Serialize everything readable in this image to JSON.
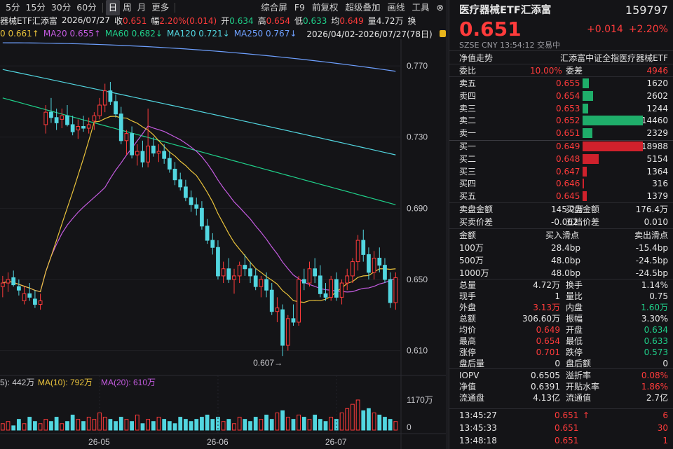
{
  "toolbar": {
    "periods": [
      "5分",
      "15分",
      "30分",
      "60分",
      "日",
      "周",
      "月",
      "更多"
    ],
    "active": "日",
    "right_items": [
      "综合屏",
      "F9",
      "前复权",
      "超级叠加",
      "画线",
      "工具"
    ]
  },
  "info_line": {
    "name": "器械ETF汇添富",
    "date": "2026/07/27",
    "close_label": "收",
    "close": "0.651",
    "change_label": "幅",
    "change": "2.20%(0.014)",
    "open_label": "开",
    "open": "0.634",
    "high_label": "高",
    "high": "0.654",
    "low_label": "低",
    "low": "0.633",
    "avg_label": "均",
    "avg": "0.649",
    "vol_label": "量",
    "vol": "4.72万",
    "exchange_label": "换"
  },
  "ma_line": {
    "ma10": "0  0.661↑",
    "ma20": "MA20  0.655↑",
    "ma60": "MA60  0.682↓",
    "ma120": "MA120  0.721↓",
    "ma250": "MA250  0.767↓",
    "range": "2026/04/02-2026/07/27(78日)"
  },
  "vol_legend": {
    "v5": "5): 442万",
    "v10": "MA(10): 792万",
    "v20": "MA(20): 610万"
  },
  "chart_data": {
    "type": "candlestick",
    "y_ticks": [
      "0.770",
      "0.730",
      "0.690",
      "0.650",
      "0.610"
    ],
    "y_tick_values": [
      0.77,
      0.73,
      0.69,
      0.65,
      0.61
    ],
    "x_ticks": [
      "26-05",
      "26-06",
      "26-07"
    ],
    "min_label": "0.607→",
    "min_value": 0.607,
    "vol_ticks": [
      "1170万",
      "0"
    ],
    "candles": [
      [
        0.646,
        0.652,
        0.64,
        0.648
      ],
      [
        0.648,
        0.654,
        0.643,
        0.65
      ],
      [
        0.651,
        0.655,
        0.646,
        0.647
      ],
      [
        0.646,
        0.65,
        0.641,
        0.644
      ],
      [
        0.638,
        0.646,
        0.636,
        0.642
      ],
      [
        0.642,
        0.648,
        0.638,
        0.64
      ],
      [
        0.639,
        0.644,
        0.634,
        0.636
      ],
      [
        0.636,
        0.642,
        0.633,
        0.638
      ],
      [
        0.737,
        0.748,
        0.732,
        0.744
      ],
      [
        0.744,
        0.752,
        0.738,
        0.741
      ],
      [
        0.741,
        0.746,
        0.734,
        0.738
      ],
      [
        0.74,
        0.746,
        0.735,
        0.742
      ],
      [
        0.742,
        0.748,
        0.736,
        0.737
      ],
      [
        0.737,
        0.742,
        0.731,
        0.733
      ],
      [
        0.734,
        0.74,
        0.729,
        0.736
      ],
      [
        0.736,
        0.742,
        0.733,
        0.735
      ],
      [
        0.735,
        0.741,
        0.732,
        0.737
      ],
      [
        0.739,
        0.744,
        0.734,
        0.742
      ],
      [
        0.742,
        0.752,
        0.74,
        0.748
      ],
      [
        0.748,
        0.76,
        0.744,
        0.756
      ],
      [
        0.756,
        0.761,
        0.748,
        0.75
      ],
      [
        0.75,
        0.754,
        0.741,
        0.743
      ],
      [
        0.743,
        0.747,
        0.726,
        0.728
      ],
      [
        0.728,
        0.734,
        0.72,
        0.732
      ],
      [
        0.732,
        0.736,
        0.718,
        0.72
      ],
      [
        0.72,
        0.726,
        0.714,
        0.722
      ],
      [
        0.722,
        0.728,
        0.713,
        0.716
      ],
      [
        0.716,
        0.746,
        0.713,
        0.725
      ],
      [
        0.725,
        0.73,
        0.719,
        0.721
      ],
      [
        0.721,
        0.726,
        0.716,
        0.722
      ],
      [
        0.722,
        0.726,
        0.715,
        0.718
      ],
      [
        0.718,
        0.722,
        0.71,
        0.712
      ],
      [
        0.712,
        0.716,
        0.703,
        0.706
      ],
      [
        0.706,
        0.71,
        0.7,
        0.702
      ],
      [
        0.702,
        0.706,
        0.694,
        0.696
      ],
      [
        0.696,
        0.7,
        0.688,
        0.692
      ],
      [
        0.692,
        0.696,
        0.686,
        0.69
      ],
      [
        0.69,
        0.694,
        0.678,
        0.68
      ],
      [
        0.68,
        0.684,
        0.67,
        0.672
      ],
      [
        0.672,
        0.676,
        0.664,
        0.668
      ],
      [
        0.668,
        0.672,
        0.65,
        0.652
      ],
      [
        0.652,
        0.66,
        0.648,
        0.656
      ],
      [
        0.656,
        0.662,
        0.648,
        0.65
      ],
      [
        0.65,
        0.656,
        0.642,
        0.652
      ],
      [
        0.652,
        0.66,
        0.648,
        0.658
      ],
      [
        0.658,
        0.664,
        0.652,
        0.656
      ],
      [
        0.656,
        0.66,
        0.648,
        0.652
      ],
      [
        0.652,
        0.656,
        0.644,
        0.646
      ],
      [
        0.646,
        0.652,
        0.64,
        0.65
      ],
      [
        0.65,
        0.654,
        0.64,
        0.644
      ],
      [
        0.644,
        0.648,
        0.63,
        0.632
      ],
      [
        0.632,
        0.64,
        0.626,
        0.634
      ],
      [
        0.633,
        0.636,
        0.607,
        0.613
      ],
      [
        0.613,
        0.63,
        0.61,
        0.628
      ],
      [
        0.628,
        0.636,
        0.624,
        0.626
      ],
      [
        0.626,
        0.652,
        0.624,
        0.65
      ],
      [
        0.65,
        0.656,
        0.644,
        0.648
      ],
      [
        0.648,
        0.66,
        0.646,
        0.656
      ],
      [
        0.656,
        0.662,
        0.648,
        0.652
      ],
      [
        0.652,
        0.658,
        0.64,
        0.642
      ],
      [
        0.642,
        0.648,
        0.638,
        0.64
      ],
      [
        0.64,
        0.652,
        0.638,
        0.65
      ],
      [
        0.65,
        0.654,
        0.638,
        0.64
      ],
      [
        0.64,
        0.65,
        0.636,
        0.648
      ],
      [
        0.648,
        0.656,
        0.644,
        0.652
      ],
      [
        0.652,
        0.662,
        0.648,
        0.66
      ],
      [
        0.66,
        0.675,
        0.655,
        0.672
      ],
      [
        0.672,
        0.678,
        0.66,
        0.664
      ],
      [
        0.664,
        0.668,
        0.65,
        0.654
      ],
      [
        0.654,
        0.666,
        0.65,
        0.662
      ],
      [
        0.662,
        0.668,
        0.654,
        0.658
      ],
      [
        0.658,
        0.662,
        0.648,
        0.65
      ],
      [
        0.65,
        0.654,
        0.634,
        0.637
      ],
      [
        0.637,
        0.654,
        0.633,
        0.651
      ]
    ],
    "volumes": [
      3,
      4,
      2,
      5,
      3,
      6,
      4,
      3,
      5,
      4,
      6,
      3,
      4,
      7,
      5,
      4,
      6,
      5,
      8,
      6,
      5,
      4,
      6,
      5,
      4,
      7,
      3,
      5,
      4,
      6,
      5,
      4,
      3,
      6,
      5,
      4,
      5,
      6,
      7,
      5,
      6,
      4,
      5,
      3,
      6,
      5,
      4,
      6,
      5,
      7,
      5,
      8,
      9,
      6,
      5,
      7,
      6,
      5,
      7,
      5,
      4,
      6,
      5,
      8,
      10,
      12,
      14,
      9,
      10,
      8,
      7,
      6,
      5,
      4
    ],
    "vol_max": 14
  },
  "panel": {
    "title": "医疗器械ETF汇添富",
    "code": "159797",
    "price": "0.651",
    "change": "+0.014",
    "change_pct": "+2.20%",
    "sub": "SZSE  CNY  13:54:12  交易中",
    "nav_label": "净值走势",
    "fund_name": "汇添富中证全指医疗器械ETF",
    "weibi_label": "委比",
    "weibi": "10.00%",
    "weicha_label": "委差",
    "weicha": "4946",
    "sells": [
      {
        "label": "卖五",
        "price": "0.655",
        "vol": "1620",
        "bar": 11
      },
      {
        "label": "卖四",
        "price": "0.654",
        "vol": "2602",
        "bar": 18
      },
      {
        "label": "卖三",
        "price": "0.653",
        "vol": "1244",
        "bar": 9
      },
      {
        "label": "卖二",
        "price": "0.652",
        "vol": "14460",
        "bar": 100
      },
      {
        "label": "卖一",
        "price": "0.651",
        "vol": "2329",
        "bar": 16
      }
    ],
    "buys": [
      {
        "label": "买一",
        "price": "0.649",
        "vol": "18988",
        "bar": 100
      },
      {
        "label": "买二",
        "price": "0.648",
        "vol": "5154",
        "bar": 27
      },
      {
        "label": "买三",
        "price": "0.647",
        "vol": "1364",
        "bar": 7
      },
      {
        "label": "买四",
        "price": "0.646",
        "vol": "316",
        "bar": 2
      },
      {
        "label": "买五",
        "price": "0.645",
        "vol": "1379",
        "bar": 7
      }
    ],
    "sell_amount_label": "卖盘金额",
    "sell_amount": "145.2万",
    "buy_amount_label": "买盘金额",
    "buy_amount": "176.4万",
    "spread_label": "买卖价差",
    "spread": "-0.002",
    "fivegap_label": "五档价差",
    "fivegap": "0.010",
    "slip_header": [
      "金额",
      "买入滑点",
      "卖出滑点"
    ],
    "slips": [
      {
        "amt": "100万",
        "buy": "28.4bp",
        "sell": "-15.4bp"
      },
      {
        "amt": "500万",
        "buy": "48.0bp",
        "sell": "-24.5bp"
      },
      {
        "amt": "1000万",
        "buy": "48.0bp",
        "sell": "-24.5bp"
      }
    ],
    "stats": [
      {
        "l1": "总量",
        "v1": "4.72万",
        "c1": "white",
        "l2": "换手",
        "v2": "1.14%",
        "c2": "white"
      },
      {
        "l1": "现手",
        "v1": "1",
        "c1": "white",
        "l2": "量比",
        "v2": "0.75",
        "c2": "white"
      },
      {
        "l1": "外盘",
        "v1": "3.13万",
        "c1": "red",
        "l2": "内盘",
        "v2": "1.60万",
        "c2": "green"
      },
      {
        "l1": "总额",
        "v1": "306.60万",
        "c1": "white",
        "l2": "振幅",
        "v2": "3.30%",
        "c2": "white"
      },
      {
        "l1": "均价",
        "v1": "0.649",
        "c1": "red",
        "l2": "开盘",
        "v2": "0.634",
        "c2": "green"
      },
      {
        "l1": "最高",
        "v1": "0.654",
        "c1": "red",
        "l2": "最低",
        "v2": "0.633",
        "c2": "green"
      },
      {
        "l1": "涨停",
        "v1": "0.701",
        "c1": "red",
        "l2": "跌停",
        "v2": "0.573",
        "c2": "green"
      },
      {
        "l1": "盘后量",
        "v1": "0",
        "c1": "white",
        "l2": "盘后额",
        "v2": "0",
        "c2": "white"
      }
    ],
    "stats2": [
      {
        "l1": "IOPV",
        "v1": "0.6505",
        "c1": "white",
        "l2": "溢折率",
        "v2": "0.08%",
        "c2": "red"
      },
      {
        "l1": "净值",
        "v1": "0.6391",
        "c1": "white",
        "l2": "开贴水率",
        "v2": "1.86%",
        "c2": "red"
      },
      {
        "l1": "流通盘",
        "v1": "4.13亿",
        "c1": "white",
        "l2": "流通值",
        "v2": "2.7亿",
        "c2": "white"
      }
    ],
    "ticks": [
      {
        "time": "13:45:27",
        "price": "0.651",
        "arrow": "↑",
        "vol": "6"
      },
      {
        "time": "13:45:33",
        "price": "0.651",
        "arrow": "",
        "vol": "30"
      },
      {
        "time": "13:48:18",
        "price": "0.651",
        "arrow": "",
        "vol": "1"
      }
    ]
  }
}
